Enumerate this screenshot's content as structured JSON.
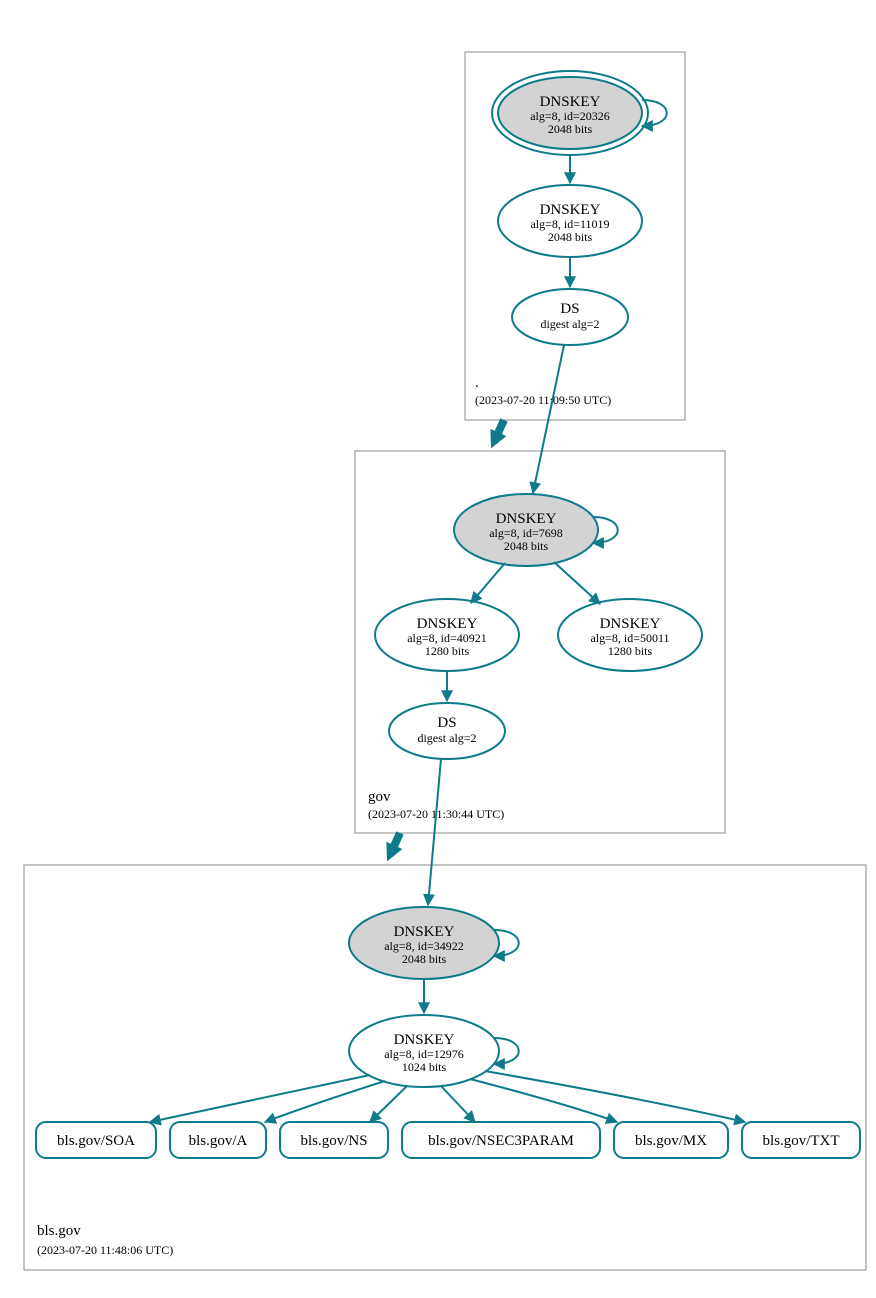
{
  "zones": {
    "root": {
      "label": ".",
      "timestamp": "(2023-07-20 11:09:50 UTC)"
    },
    "gov": {
      "label": "gov",
      "timestamp": "(2023-07-20 11:30:44 UTC)"
    },
    "blsgov": {
      "label": "bls.gov",
      "timestamp": "(2023-07-20 11:48:06 UTC)"
    }
  },
  "nodes": {
    "root_ksk": {
      "title": "DNSKEY",
      "line1": "alg=8, id=20326",
      "line2": "2048 bits"
    },
    "root_zsk": {
      "title": "DNSKEY",
      "line1": "alg=8, id=11019",
      "line2": "2048 bits"
    },
    "root_ds": {
      "title": "DS",
      "line1": "digest alg=2"
    },
    "gov_ksk": {
      "title": "DNSKEY",
      "line1": "alg=8, id=7698",
      "line2": "2048 bits"
    },
    "gov_zsk1": {
      "title": "DNSKEY",
      "line1": "alg=8, id=40921",
      "line2": "1280 bits"
    },
    "gov_zsk2": {
      "title": "DNSKEY",
      "line1": "alg=8, id=50011",
      "line2": "1280 bits"
    },
    "gov_ds": {
      "title": "DS",
      "line1": "digest alg=2"
    },
    "bls_ksk": {
      "title": "DNSKEY",
      "line1": "alg=8, id=34922",
      "line2": "2048 bits"
    },
    "bls_zsk": {
      "title": "DNSKEY",
      "line1": "alg=8, id=12976",
      "line2": "1024 bits"
    }
  },
  "records": {
    "soa": "bls.gov/SOA",
    "a": "bls.gov/A",
    "ns": "bls.gov/NS",
    "nsec3": "bls.gov/NSEC3PARAM",
    "mx": "bls.gov/MX",
    "txt": "bls.gov/TXT"
  }
}
